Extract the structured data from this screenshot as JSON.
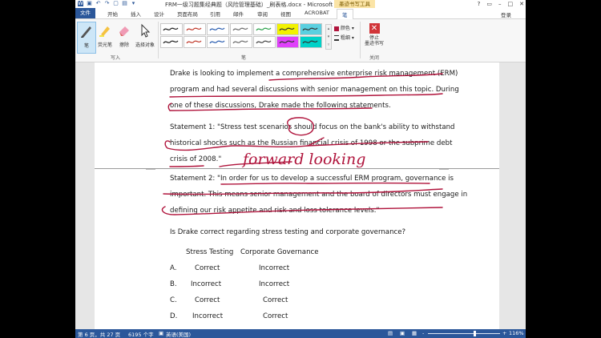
{
  "window": {
    "title": "FRM一级习题集经典题（风险管理基础）_刷表格.docx - Microsoft ...",
    "tool_context": "墨迹书写工具",
    "help": "?",
    "login": "登录"
  },
  "tabs": [
    "文件",
    "开始",
    "插入",
    "设计",
    "页面布局",
    "引用",
    "邮件",
    "审阅",
    "视图",
    "ACROBAT",
    "笔"
  ],
  "ribbon": {
    "write_group": {
      "label": "写入",
      "buttons": [
        "笔",
        "荧光笔",
        "擦除",
        "选择对象"
      ]
    },
    "pens_group": {
      "label": "笔"
    },
    "color_label": "颜色",
    "thickness_label": "粗细",
    "close_group": {
      "label": "关闭",
      "stop_label_1": "停止",
      "stop_label_2": "墨迹书写"
    },
    "pen_colors": [
      "#1f1f1f",
      "#c0392b",
      "#2a5db0",
      "#6b6b6b",
      "#2aa14a",
      "#f2f200",
      "#5ad0e0",
      "#1f1f1f",
      "#c0392b",
      "#2a5db0",
      "#6b6b6b",
      "#444444",
      "#e040fb",
      "#00d2c8"
    ]
  },
  "document": {
    "paragraph1": [
      "Drake is looking to implement a comprehensive enterprise risk management (ERM)",
      "program and had several discussions with senior management on this topic. During",
      "one of these discussions, Drake made the following statements."
    ],
    "statement1": [
      "Statement 1: \"Stress test scenarios should focus on the bank's ability to withstand",
      "historical shocks such as the Russian financial crisis of 1998 or the subprime debt",
      "crisis of 2008.\""
    ],
    "statement2": [
      "Statement 2: \"In order for us to develop a successful ERM program, governance is",
      "important. This means senior management and the board of directors must engage in",
      "defining our risk appetite and risk and loss tolerance levels.\""
    ],
    "question": "Is Drake correct regarding stress testing and corporate governance?",
    "table_headers": [
      "Stress Testing",
      "Corporate Governance"
    ],
    "options": [
      {
        "letter": "A.",
        "stress": "Correct",
        "governance": "Incorrect"
      },
      {
        "letter": "B.",
        "stress": "Incorrect",
        "governance": "Incorrect"
      },
      {
        "letter": "C.",
        "stress": "Correct",
        "governance": "Correct"
      },
      {
        "letter": "D.",
        "stress": "Incorrect",
        "governance": "Correct"
      }
    ],
    "handwriting": "forward looking",
    "ink_color": "#b0143c"
  },
  "status_bar": {
    "page": "第 6 页，共 27 页",
    "words": "6195 个字",
    "lang": "英语(美国)",
    "zoom": "116%",
    "zoom_minus": "-",
    "zoom_plus": "+"
  }
}
